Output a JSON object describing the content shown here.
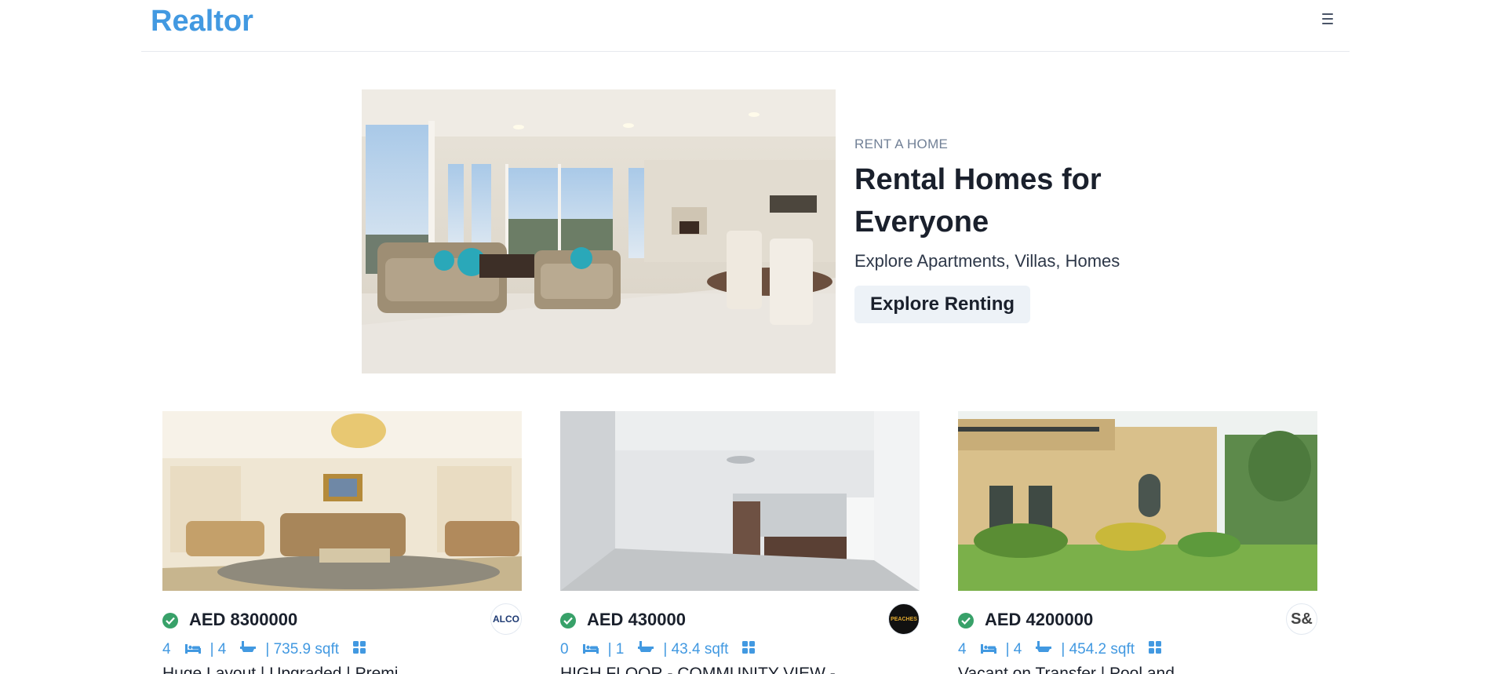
{
  "nav": {
    "brand": "Realtor"
  },
  "hero": {
    "eyebrow": "RENT A HOME",
    "title": "Rental Homes for Everyone",
    "subtitle": "Explore Apartments, Villas, Homes",
    "button": "Explore Renting"
  },
  "listings": [
    {
      "price": "AED 8300000",
      "rooms": "4",
      "baths": "| 4",
      "area": "| 735.9 sqft",
      "title": "Huge Layout | Upgraded | Premi...",
      "agency_logo": "ALCO"
    },
    {
      "price": "AED 430000",
      "rooms": "0",
      "baths": "| 1",
      "area": "| 43.4 sqft",
      "title": "HIGH FLOOR - COMMUNITY VIEW - ...",
      "agency_logo": "PEACHES"
    },
    {
      "price": "AED 4200000",
      "rooms": "4",
      "baths": "| 4",
      "area": "| 454.2 sqft",
      "title": "Vacant on Transfer | Pool and ...",
      "agency_logo": "S&"
    }
  ],
  "colors": {
    "brand": "#4299e1",
    "verified": "#38a169",
    "stats": "#4299e1",
    "button_bg": "#edf2f7"
  },
  "icons": {
    "menu": "hamburger-icon",
    "verified": "check-circle-icon",
    "rooms": "bed-icon",
    "baths": "bath-icon",
    "area": "grid-icon"
  }
}
